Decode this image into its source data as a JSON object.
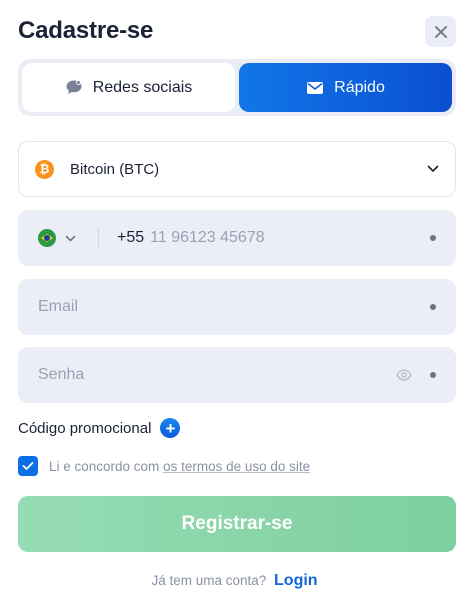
{
  "header": {
    "title": "Cadastre-se",
    "close_icon": "close-icon"
  },
  "tabs": [
    {
      "label": "Redes sociais",
      "icon": "chat-bubble-icon",
      "active": false
    },
    {
      "label": "Rápido",
      "icon": "envelope-icon",
      "active": true
    }
  ],
  "currency": {
    "icon": "bitcoin-icon",
    "label": "Bitcoin (BTC)"
  },
  "phone": {
    "country_icon": "brazil-flag-icon",
    "prefix": "+55",
    "placeholder": "11 96123 45678"
  },
  "email": {
    "placeholder": "Email"
  },
  "password": {
    "placeholder": "Senha",
    "icon": "eye-icon"
  },
  "promo": {
    "label": "Código promocional",
    "button": "+"
  },
  "terms": {
    "prefix": "Li e concordo com",
    "link": "os termos de uso do site",
    "checked": true
  },
  "register": {
    "label": "Registrar-se"
  },
  "footer": {
    "text": "Já tem uma conta?",
    "link": "Login"
  },
  "colors": {
    "accent": "#0d6fe6",
    "register_button": "#8ad6a9",
    "field_bg": "#eceef7",
    "bitcoin": "#f7931a"
  }
}
